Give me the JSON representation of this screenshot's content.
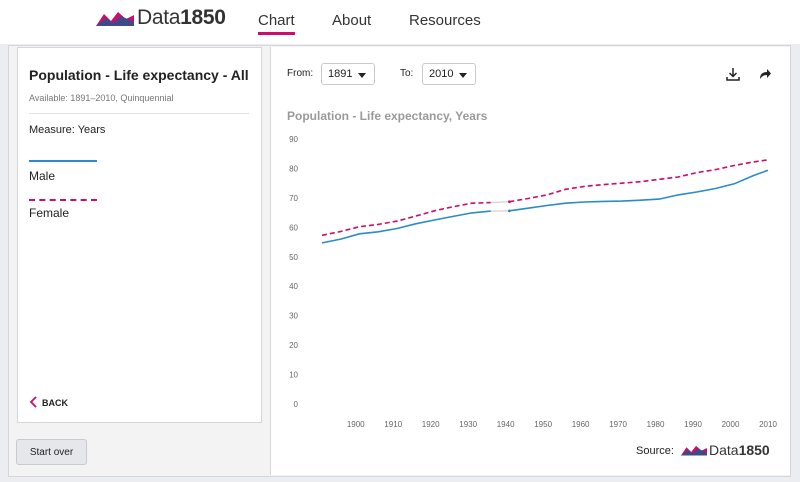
{
  "header": {
    "logo": {
      "prefix": "Data",
      "suffix": "1850"
    },
    "nav": [
      {
        "label": "Chart",
        "active": true
      },
      {
        "label": "About",
        "active": false
      },
      {
        "label": "Resources",
        "active": false
      }
    ]
  },
  "sidebar": {
    "title": "Population - Life expectancy - All",
    "available": "Available: 1891–2010, Quinquennial",
    "measure": "Measure:  Years",
    "legend": [
      {
        "label": "Male",
        "color": "#2a8bc6",
        "style": "solid"
      },
      {
        "label": "Female",
        "color": "#cc0d6d",
        "style": "dashed"
      }
    ],
    "back_label": "BACK"
  },
  "start_over_label": "Start over",
  "controls": {
    "from_label": "From:",
    "from_value": "1891",
    "to_label": "To:",
    "to_value": "2010",
    "icons": [
      "download-icon",
      "share-icon"
    ]
  },
  "source_label": "Source:",
  "chart_data": {
    "type": "line",
    "title": "Population - Life expectancy, Years",
    "xlabel": "",
    "ylabel": "",
    "xlim": [
      1891,
      2010
    ],
    "ylim": [
      0,
      90
    ],
    "xticks": [
      1900,
      1910,
      1920,
      1930,
      1940,
      1950,
      1960,
      1970,
      1980,
      1990,
      2000,
      2010
    ],
    "yticks": [
      0,
      10,
      20,
      30,
      40,
      50,
      60,
      70,
      80,
      90
    ],
    "grid": false,
    "gap": [
      1938,
      1941
    ],
    "series": [
      {
        "name": "Male",
        "color": "#2a8bc6",
        "style": "solid",
        "x": [
          1891,
          1896,
          1901,
          1906,
          1911,
          1916,
          1921,
          1926,
          1931,
          1936,
          1941,
          1946,
          1951,
          1956,
          1961,
          1966,
          1971,
          1976,
          1981,
          1986,
          1991,
          1996,
          2001,
          2006,
          2010
        ],
        "values": [
          54.7,
          56.0,
          57.8,
          58.5,
          59.6,
          61.2,
          62.5,
          63.7,
          64.9,
          65.5,
          65.6,
          66.5,
          67.4,
          68.2,
          68.6,
          68.8,
          68.9,
          69.2,
          69.6,
          71.0,
          72.0,
          73.2,
          74.8,
          77.5,
          79.4
        ]
      },
      {
        "name": "Female",
        "color": "#cc0d6d",
        "style": "dashed",
        "x": [
          1891,
          1896,
          1901,
          1906,
          1911,
          1916,
          1921,
          1926,
          1931,
          1936,
          1941,
          1946,
          1951,
          1956,
          1961,
          1966,
          1971,
          1976,
          1981,
          1986,
          1991,
          1996,
          2001,
          2006,
          2010
        ],
        "values": [
          57.3,
          58.6,
          60.2,
          61.0,
          62.1,
          63.8,
          65.6,
          67.0,
          68.2,
          68.4,
          68.7,
          69.8,
          71.0,
          72.9,
          73.9,
          74.5,
          75.0,
          75.5,
          76.3,
          77.1,
          78.6,
          79.6,
          81.0,
          82.2,
          82.9
        ]
      }
    ]
  }
}
